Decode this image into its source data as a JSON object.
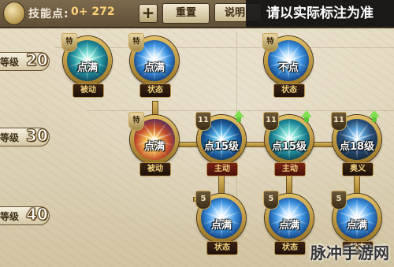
{
  "header": {
    "skill_points_label": "技能点:",
    "skill_points_value": "0+ 272",
    "plus_label": "+",
    "reset_label": "重置",
    "info_label": "说明",
    "overlay_note": "请以实际标注为准"
  },
  "levels": [
    {
      "text": "等级",
      "num": "20"
    },
    {
      "text": "等级",
      "num": "30"
    },
    {
      "text": "等级",
      "num": "40"
    }
  ],
  "skills": [
    {
      "state": "点满",
      "tag": "被动",
      "badge": "特",
      "style": "teal"
    },
    {
      "state": "点满",
      "tag": "状态",
      "badge": "特",
      "style": "blue"
    },
    {
      "state": "不点",
      "tag": "状态",
      "badge": "特",
      "style": "blue"
    },
    {
      "state": "点满",
      "tag": "被动",
      "badge": "特",
      "style": "gold"
    },
    {
      "state": "点15级",
      "tag": "主动",
      "badge": "11",
      "style": "rune",
      "upgrade": true
    },
    {
      "state": "点15级",
      "tag": "主动",
      "badge": "11",
      "style": "teal",
      "upgrade": true
    },
    {
      "state": "点18级",
      "tag": "奥义",
      "badge": "11",
      "style": "dark",
      "upgrade": true
    },
    {
      "state": "点满",
      "tag": "状态",
      "badge": "5",
      "style": "blue"
    },
    {
      "state": "点满",
      "tag": "状态",
      "badge": "5",
      "style": "blue"
    },
    {
      "state": "点满",
      "tag": "状态",
      "badge": "5",
      "style": "blue"
    }
  ],
  "watermark": "脉冲手游网",
  "colors": {
    "accent_gold": "#d7b765",
    "tag_text": "#f1d27f",
    "upgrade_arrow": "#7ee04f",
    "overlay_bg": "#141414"
  }
}
